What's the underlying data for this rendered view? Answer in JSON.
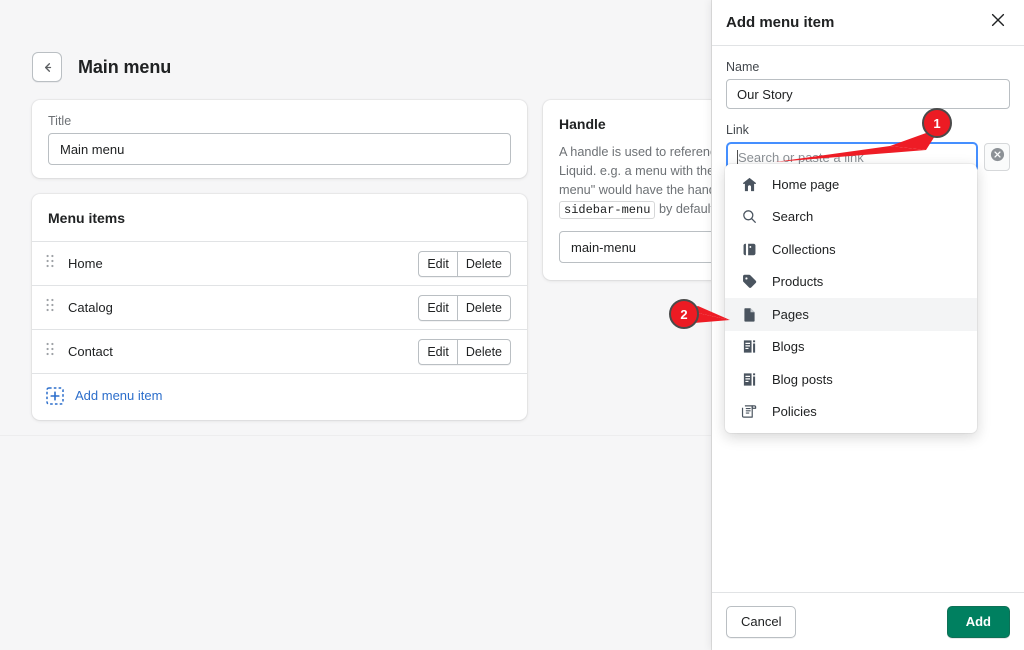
{
  "page": {
    "title": "Main menu",
    "back_icon": "arrow-left-icon",
    "title_card": {
      "label": "Title",
      "value": "Main menu"
    },
    "menu_items_card": {
      "heading": "Menu items",
      "rows": [
        {
          "label": "Home",
          "edit": "Edit",
          "delete": "Delete",
          "handle_icon": "drag-handle-icon"
        },
        {
          "label": "Catalog",
          "edit": "Edit",
          "delete": "Delete",
          "handle_icon": "drag-handle-icon"
        },
        {
          "label": "Contact",
          "edit": "Edit",
          "delete": "Delete",
          "handle_icon": "drag-handle-icon"
        }
      ],
      "add_label": "Add menu item",
      "add_icon": "add-square-icon"
    },
    "handle_card": {
      "heading": "Handle",
      "description_part1": "A handle is used to reference",
      "description_part2": "Liquid. e.g. a menu with the ti",
      "description_part3": "menu\" would have the handle",
      "code": "sidebar-menu",
      "description_part4": "by default.",
      "value": "main-menu"
    }
  },
  "panel": {
    "title": "Add menu item",
    "close_icon": "close-icon",
    "name": {
      "label": "Name",
      "value": "Our Story"
    },
    "link": {
      "label": "Link",
      "value": "",
      "placeholder": "Search or paste a link",
      "clear_icon": "clear-circle-icon"
    },
    "dropdown": {
      "items": [
        {
          "label": "Home page",
          "icon": "home-icon",
          "active": false
        },
        {
          "label": "Search",
          "icon": "search-icon",
          "active": false
        },
        {
          "label": "Collections",
          "icon": "collection-icon",
          "active": false
        },
        {
          "label": "Products",
          "icon": "product-tag-icon",
          "active": false
        },
        {
          "label": "Pages",
          "icon": "page-icon",
          "active": true
        },
        {
          "label": "Blogs",
          "icon": "blog-icon",
          "active": false
        },
        {
          "label": "Blog posts",
          "icon": "blog-post-icon",
          "active": false
        },
        {
          "label": "Policies",
          "icon": "policy-icon",
          "active": false
        }
      ]
    },
    "footer": {
      "cancel_label": "Cancel",
      "add_label": "Add"
    }
  },
  "annotations": [
    {
      "number": "1",
      "target": "link-input"
    },
    {
      "number": "2",
      "target": "dropdown-item-pages"
    }
  ],
  "colors": {
    "accent_green": "#008060",
    "link_blue": "#2c6ecb",
    "focus_blue": "#458fff",
    "annotation_red": "#ec1b23",
    "background": "#f6f6f7",
    "surface": "#ffffff"
  }
}
